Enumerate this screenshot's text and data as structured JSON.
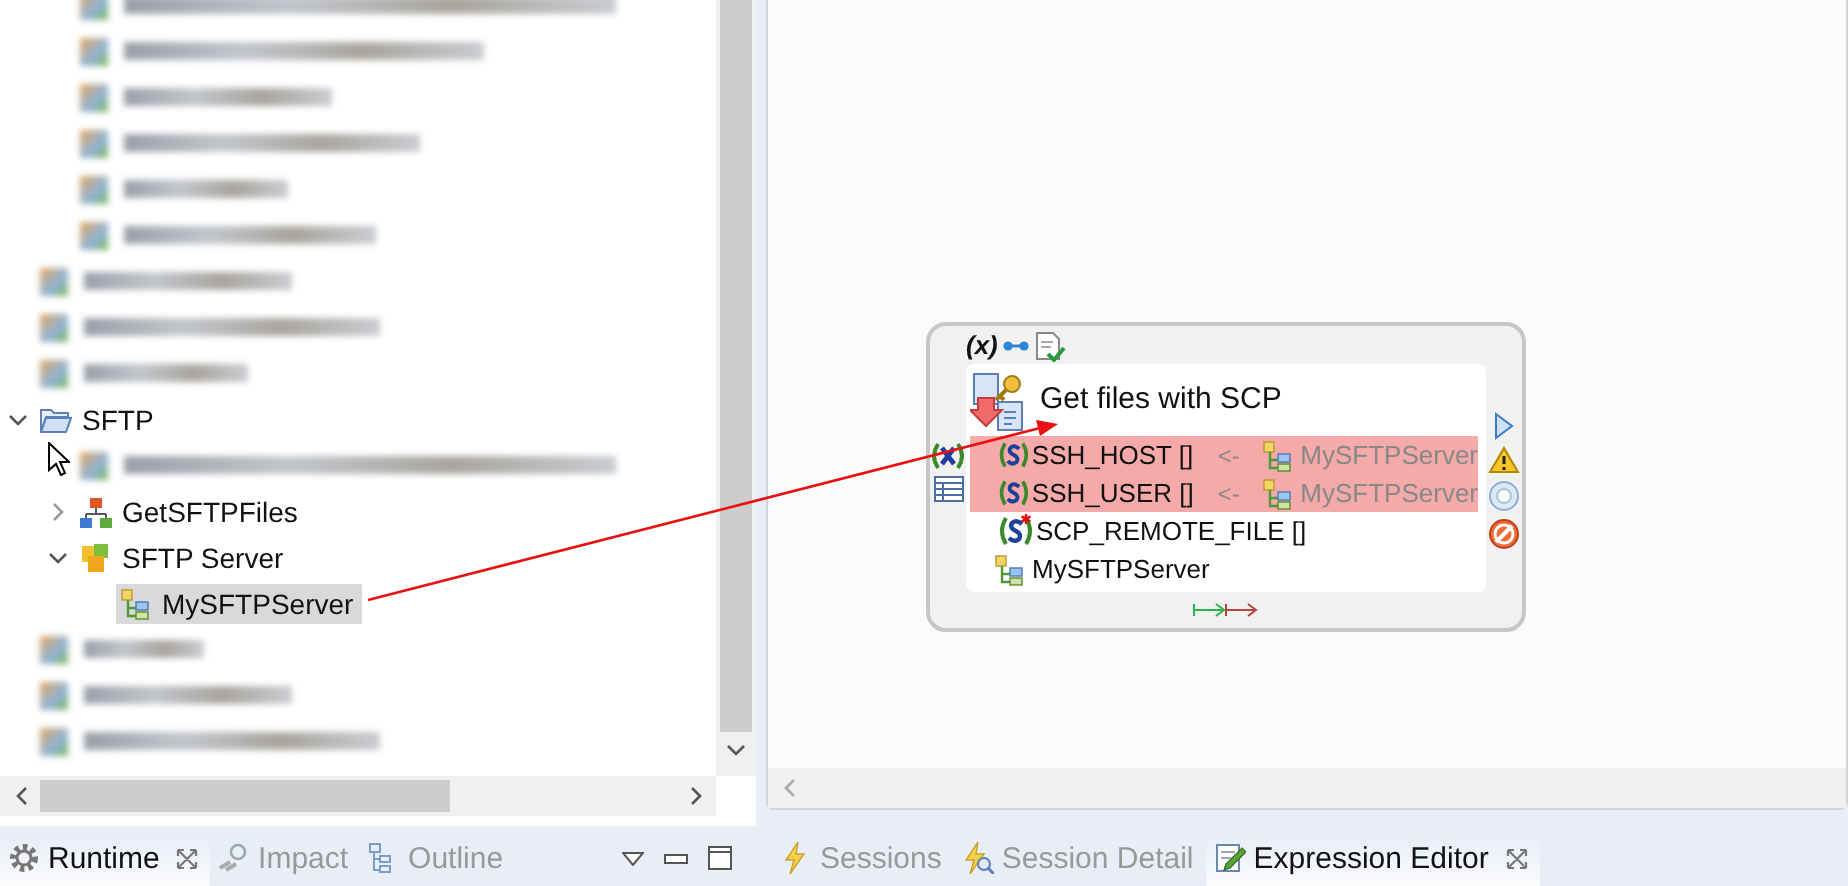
{
  "tree": {
    "items": [
      {
        "children": [
          {
            "kind": "blurred"
          },
          {
            "kind": "blurred"
          },
          {
            "kind": "blurred"
          },
          {
            "kind": "blurred"
          },
          {
            "kind": "blurred"
          },
          {
            "kind": "blurred"
          }
        ]
      },
      {
        "kind": "blurred"
      },
      {
        "kind": "blurred"
      },
      {
        "kind": "blurred"
      },
      {
        "kind": "folder",
        "label": "SFTP",
        "expanded": true,
        "selected": false,
        "children": [
          {
            "kind": "blurred"
          },
          {
            "kind": "process",
            "label": "GetSFTPFiles",
            "expanded": false,
            "selected": false
          },
          {
            "kind": "group",
            "label": "SFTP Server",
            "expanded": true,
            "selected": false,
            "children": [
              {
                "kind": "resource",
                "label": "MySFTPServer",
                "selected": true
              }
            ]
          }
        ]
      },
      {
        "kind": "blurred"
      },
      {
        "kind": "blurred"
      },
      {
        "kind": "blurred"
      }
    ]
  },
  "left_tabs": [
    {
      "label": "Runtime",
      "kind": "runtime",
      "selected": true
    },
    {
      "label": "Impact",
      "kind": "impact",
      "selected": false
    },
    {
      "label": "Outline",
      "kind": "outline",
      "selected": false
    }
  ],
  "node": {
    "variables_label": "(x)",
    "title": "Get files with SCP",
    "params": [
      {
        "name": "SSH_HOST []",
        "required": false,
        "highlighted": true,
        "mapping": {
          "arrow": "<-",
          "source": "MySFTPServer"
        }
      },
      {
        "name": "SSH_USER []",
        "required": false,
        "highlighted": true,
        "mapping": {
          "arrow": "<-",
          "source": "MySFTPServer"
        }
      },
      {
        "name": "SCP_REMOTE_FILE []",
        "required": true,
        "highlighted": false
      }
    ],
    "resource": "MySFTPServer"
  },
  "right_tabs": [
    {
      "label": "Sessions",
      "kind": "sessions",
      "selected": false
    },
    {
      "label": "Session Detail",
      "kind": "detail",
      "selected": false
    },
    {
      "label": "Expression Editor",
      "kind": "editor",
      "selected": true
    }
  ]
}
